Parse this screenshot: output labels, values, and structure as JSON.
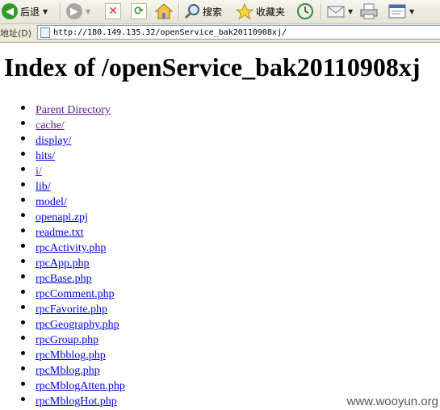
{
  "toolbar": {
    "back_label": "后退",
    "search_label": "搜索",
    "favorites_label": "收藏夹"
  },
  "addressbar": {
    "label": "地址(D)",
    "url": "http://180.149.135.32/openService_bak20110908xj/"
  },
  "page": {
    "title": "Index of /openService_bak20110908xj",
    "entries": [
      {
        "label": "Parent Directory",
        "visited": true
      },
      {
        "label": "cache/",
        "visited": true
      },
      {
        "label": "display/",
        "visited": false
      },
      {
        "label": "hits/",
        "visited": false
      },
      {
        "label": "i/",
        "visited": true
      },
      {
        "label": "lib/",
        "visited": false
      },
      {
        "label": "model/",
        "visited": false
      },
      {
        "label": "openapi.zpj",
        "visited": false
      },
      {
        "label": "readme.txt",
        "visited": false
      },
      {
        "label": "rpcActivity.php",
        "visited": false
      },
      {
        "label": "rpcApp.php",
        "visited": false
      },
      {
        "label": "rpcBase.php",
        "visited": false
      },
      {
        "label": "rpcComment.php",
        "visited": false
      },
      {
        "label": "rpcFavorite.php",
        "visited": false
      },
      {
        "label": "rpcGeography.php",
        "visited": false
      },
      {
        "label": "rpcGroup.php",
        "visited": false
      },
      {
        "label": "rpcMbblog.php",
        "visited": false
      },
      {
        "label": "rpcMblog.php",
        "visited": false
      },
      {
        "label": "rpcMblogAtten.php",
        "visited": false
      },
      {
        "label": "rpcMblogHot.php",
        "visited": false
      }
    ]
  },
  "watermark": "www.wooyun.org",
  "colors": {
    "link": "#0000ee",
    "visited_link": "#551a8b",
    "back_button": "#2e9a2e",
    "stop_button": "#d62b1f",
    "refresh_button": "#3a9a3a"
  },
  "icons": [
    "back-icon",
    "forward-icon",
    "stop-icon",
    "refresh-icon",
    "home-icon",
    "search-icon",
    "favorites-star-icon",
    "history-icon",
    "mail-icon",
    "print-icon",
    "edit-icon"
  ]
}
